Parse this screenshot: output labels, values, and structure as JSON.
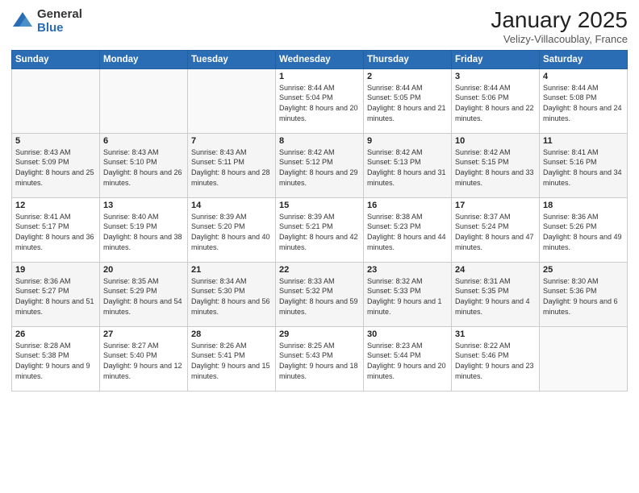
{
  "logo": {
    "general": "General",
    "blue": "Blue"
  },
  "header": {
    "month": "January 2025",
    "location": "Velizy-Villacoublay, France"
  },
  "weekdays": [
    "Sunday",
    "Monday",
    "Tuesday",
    "Wednesday",
    "Thursday",
    "Friday",
    "Saturday"
  ],
  "weeks": [
    [
      {
        "day": "",
        "info": ""
      },
      {
        "day": "",
        "info": ""
      },
      {
        "day": "",
        "info": ""
      },
      {
        "day": "1",
        "info": "Sunrise: 8:44 AM\nSunset: 5:04 PM\nDaylight: 8 hours and 20 minutes."
      },
      {
        "day": "2",
        "info": "Sunrise: 8:44 AM\nSunset: 5:05 PM\nDaylight: 8 hours and 21 minutes."
      },
      {
        "day": "3",
        "info": "Sunrise: 8:44 AM\nSunset: 5:06 PM\nDaylight: 8 hours and 22 minutes."
      },
      {
        "day": "4",
        "info": "Sunrise: 8:44 AM\nSunset: 5:08 PM\nDaylight: 8 hours and 24 minutes."
      }
    ],
    [
      {
        "day": "5",
        "info": "Sunrise: 8:43 AM\nSunset: 5:09 PM\nDaylight: 8 hours and 25 minutes."
      },
      {
        "day": "6",
        "info": "Sunrise: 8:43 AM\nSunset: 5:10 PM\nDaylight: 8 hours and 26 minutes."
      },
      {
        "day": "7",
        "info": "Sunrise: 8:43 AM\nSunset: 5:11 PM\nDaylight: 8 hours and 28 minutes."
      },
      {
        "day": "8",
        "info": "Sunrise: 8:42 AM\nSunset: 5:12 PM\nDaylight: 8 hours and 29 minutes."
      },
      {
        "day": "9",
        "info": "Sunrise: 8:42 AM\nSunset: 5:13 PM\nDaylight: 8 hours and 31 minutes."
      },
      {
        "day": "10",
        "info": "Sunrise: 8:42 AM\nSunset: 5:15 PM\nDaylight: 8 hours and 33 minutes."
      },
      {
        "day": "11",
        "info": "Sunrise: 8:41 AM\nSunset: 5:16 PM\nDaylight: 8 hours and 34 minutes."
      }
    ],
    [
      {
        "day": "12",
        "info": "Sunrise: 8:41 AM\nSunset: 5:17 PM\nDaylight: 8 hours and 36 minutes."
      },
      {
        "day": "13",
        "info": "Sunrise: 8:40 AM\nSunset: 5:19 PM\nDaylight: 8 hours and 38 minutes."
      },
      {
        "day": "14",
        "info": "Sunrise: 8:39 AM\nSunset: 5:20 PM\nDaylight: 8 hours and 40 minutes."
      },
      {
        "day": "15",
        "info": "Sunrise: 8:39 AM\nSunset: 5:21 PM\nDaylight: 8 hours and 42 minutes."
      },
      {
        "day": "16",
        "info": "Sunrise: 8:38 AM\nSunset: 5:23 PM\nDaylight: 8 hours and 44 minutes."
      },
      {
        "day": "17",
        "info": "Sunrise: 8:37 AM\nSunset: 5:24 PM\nDaylight: 8 hours and 47 minutes."
      },
      {
        "day": "18",
        "info": "Sunrise: 8:36 AM\nSunset: 5:26 PM\nDaylight: 8 hours and 49 minutes."
      }
    ],
    [
      {
        "day": "19",
        "info": "Sunrise: 8:36 AM\nSunset: 5:27 PM\nDaylight: 8 hours and 51 minutes."
      },
      {
        "day": "20",
        "info": "Sunrise: 8:35 AM\nSunset: 5:29 PM\nDaylight: 8 hours and 54 minutes."
      },
      {
        "day": "21",
        "info": "Sunrise: 8:34 AM\nSunset: 5:30 PM\nDaylight: 8 hours and 56 minutes."
      },
      {
        "day": "22",
        "info": "Sunrise: 8:33 AM\nSunset: 5:32 PM\nDaylight: 8 hours and 59 minutes."
      },
      {
        "day": "23",
        "info": "Sunrise: 8:32 AM\nSunset: 5:33 PM\nDaylight: 9 hours and 1 minute."
      },
      {
        "day": "24",
        "info": "Sunrise: 8:31 AM\nSunset: 5:35 PM\nDaylight: 9 hours and 4 minutes."
      },
      {
        "day": "25",
        "info": "Sunrise: 8:30 AM\nSunset: 5:36 PM\nDaylight: 9 hours and 6 minutes."
      }
    ],
    [
      {
        "day": "26",
        "info": "Sunrise: 8:28 AM\nSunset: 5:38 PM\nDaylight: 9 hours and 9 minutes."
      },
      {
        "day": "27",
        "info": "Sunrise: 8:27 AM\nSunset: 5:40 PM\nDaylight: 9 hours and 12 minutes."
      },
      {
        "day": "28",
        "info": "Sunrise: 8:26 AM\nSunset: 5:41 PM\nDaylight: 9 hours and 15 minutes."
      },
      {
        "day": "29",
        "info": "Sunrise: 8:25 AM\nSunset: 5:43 PM\nDaylight: 9 hours and 18 minutes."
      },
      {
        "day": "30",
        "info": "Sunrise: 8:23 AM\nSunset: 5:44 PM\nDaylight: 9 hours and 20 minutes."
      },
      {
        "day": "31",
        "info": "Sunrise: 8:22 AM\nSunset: 5:46 PM\nDaylight: 9 hours and 23 minutes."
      },
      {
        "day": "",
        "info": ""
      }
    ]
  ]
}
